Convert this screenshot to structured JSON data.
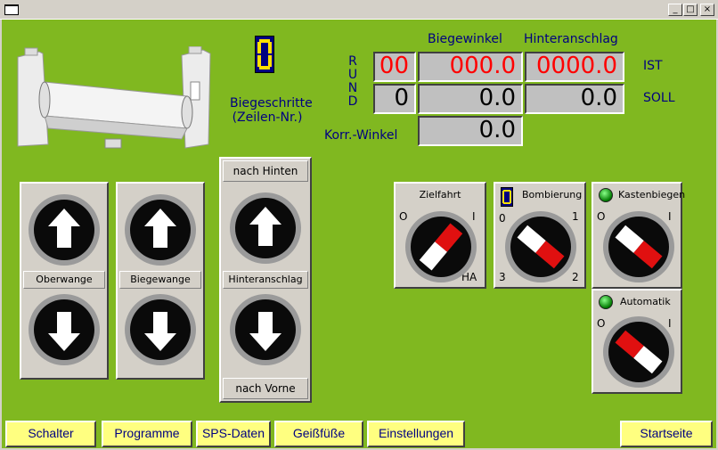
{
  "window": {
    "controls": {
      "minimize": "_",
      "maximize": "□",
      "close": "×"
    }
  },
  "header": {
    "steps_label_line1": "Biegeschritte",
    "steps_label_line2": "(Zeilen-Nr.)",
    "rund_letters": [
      "R",
      "U",
      "N",
      "D"
    ],
    "col_biegewinkel": "Biegewinkel",
    "col_hinteranschlag": "Hinteranschlag",
    "row_ist": "IST",
    "row_soll": "SOLL",
    "korr_label": "Korr.-Winkel"
  },
  "displays": {
    "rund_ist": "00",
    "biegewinkel_ist": "000.0",
    "hinteranschlag_ist": "0000.0",
    "rund_soll": "0",
    "biegewinkel_soll": "0.0",
    "hinteranschlag_soll": "0.0",
    "korr_winkel": "0.0"
  },
  "jog_buttons": {
    "oberwange": "Oberwange",
    "biegewange": "Biegewange",
    "hinteranschlag": "Hinteranschlag",
    "nach_hinten": "nach Hinten",
    "nach_vorne": "nach Vorne"
  },
  "selectors": {
    "zielfahrt": {
      "label": "Zielfahrt",
      "pos_left": "O",
      "pos_right": "I",
      "pos_bottom": "HA"
    },
    "bombierung": {
      "label": "Bombierung",
      "pos_tl": "0",
      "pos_tr": "1",
      "pos_bl": "3",
      "pos_br": "2"
    },
    "kastenbiegen": {
      "label": "Kastenbiegen",
      "pos_left": "O",
      "pos_right": "I"
    },
    "automatik": {
      "label": "Automatik",
      "pos_left": "O",
      "pos_right": "I"
    }
  },
  "nav": {
    "schalter": "Schalter",
    "programme": "Programme",
    "sps_daten": "SPS-Daten",
    "geissfuesse": "Geißfüße",
    "einstellungen": "Einstellungen",
    "startseite": "Startseite"
  },
  "colors": {
    "panel_bg": "#80b820",
    "display_red": "#ff0000",
    "nav_bg": "#ffff80",
    "nav_text": "#000080"
  }
}
